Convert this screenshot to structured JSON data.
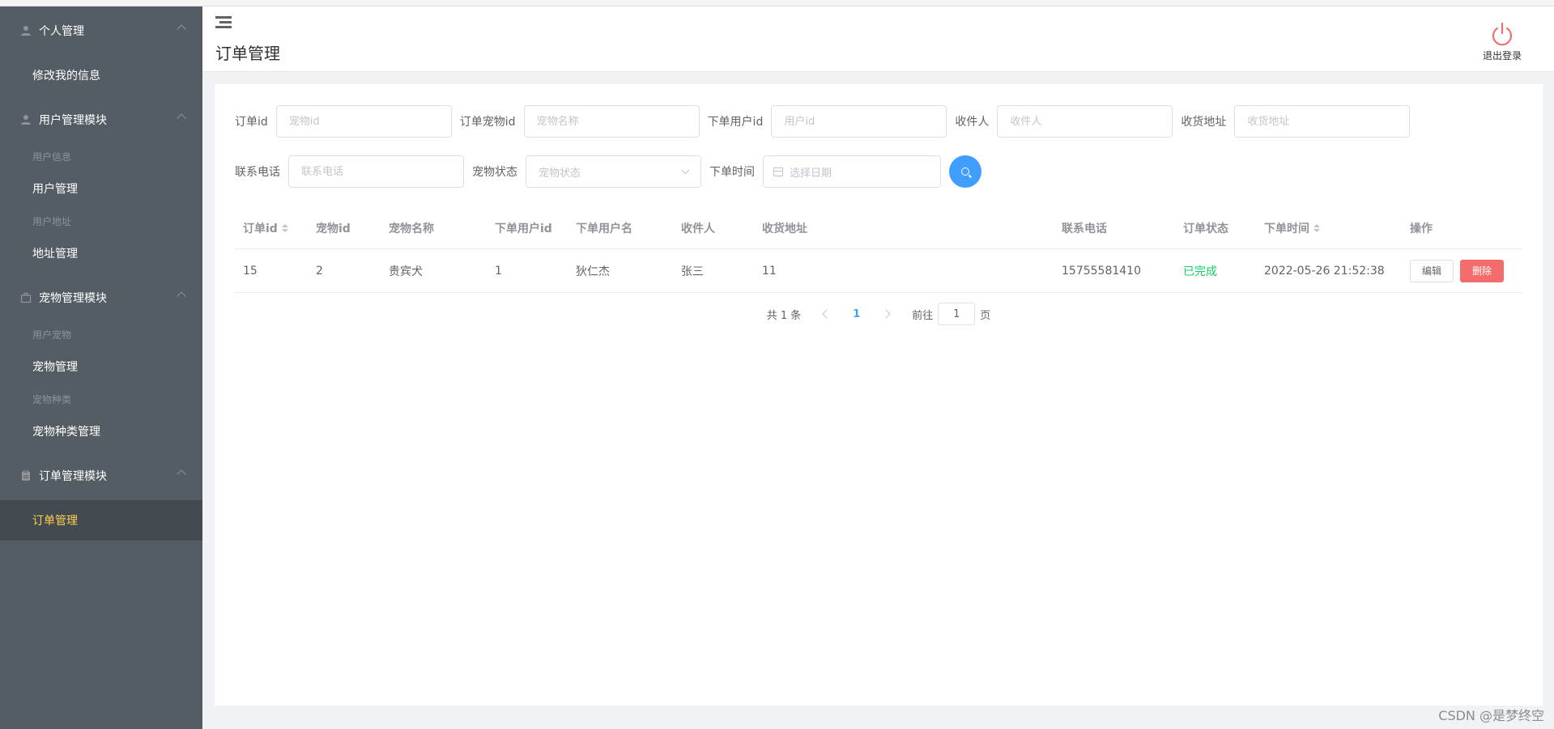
{
  "sidebar": {
    "groups": [
      {
        "title": "个人管理",
        "icon": "user-icon",
        "items": [
          {
            "label": "修改我的信息",
            "style": "item"
          }
        ]
      },
      {
        "title": "用户管理模块",
        "icon": "user-icon",
        "items": [
          {
            "label": "用户信息",
            "style": "small"
          },
          {
            "label": "用户管理",
            "style": "item"
          },
          {
            "label": "用户地址",
            "style": "small"
          },
          {
            "label": "地址管理",
            "style": "item"
          }
        ]
      },
      {
        "title": "宠物管理模块",
        "icon": "briefcase-icon",
        "items": [
          {
            "label": "用户宠物",
            "style": "small"
          },
          {
            "label": "宠物管理",
            "style": "item"
          },
          {
            "label": "宠物种类",
            "style": "small"
          },
          {
            "label": "宠物种类管理",
            "style": "item"
          }
        ]
      },
      {
        "title": "订单管理模块",
        "icon": "clipboard-icon",
        "items": [
          {
            "label": "订单管理",
            "style": "active"
          }
        ]
      }
    ],
    "active_color": "#ffd04b",
    "background": "#545c64"
  },
  "header": {
    "title": "订单管理",
    "logout_label": "退出登录",
    "logout_icon": "power-icon",
    "menu_icon": "menu-fold-icon"
  },
  "filters": {
    "order_id": {
      "label": "订单id",
      "placeholder": "宠物id"
    },
    "pet_id": {
      "label": "订单宠物id",
      "placeholder": "宠物名称"
    },
    "user_id": {
      "label": "下单用户id",
      "placeholder": "用户id"
    },
    "receiver": {
      "label": "收件人",
      "placeholder": "收件人"
    },
    "address": {
      "label": "收货地址",
      "placeholder": "收货地址"
    },
    "phone": {
      "label": "联系电话",
      "placeholder": "联系电话"
    },
    "pet_status": {
      "label": "宠物状态",
      "placeholder": "宠物状态"
    },
    "order_time": {
      "label": "下单时间",
      "placeholder": "选择日期"
    },
    "search_icon": "search-icon"
  },
  "table": {
    "columns": [
      "订单id",
      "宠物id",
      "宠物名称",
      "下单用户id",
      "下单用户名",
      "收件人",
      "收货地址",
      "联系电话",
      "订单状态",
      "下单时间",
      "操作"
    ],
    "rows": [
      {
        "order_id": "15",
        "pet_id": "2",
        "pet_name": "贵宾犬",
        "user_id": "1",
        "username": "狄仁杰",
        "receiver": "张三",
        "address": "11",
        "phone": "15755581410",
        "status": "已完成",
        "time": "2022-05-26 21:52:38",
        "edit": "编辑",
        "delete": "删除"
      }
    ],
    "status_color": "#13ce66"
  },
  "pagination": {
    "total": "共 1 条",
    "current_page": "1",
    "goto_prefix": "前往",
    "goto_value": "1",
    "goto_suffix": "页"
  },
  "watermark": "CSDN @是梦终空",
  "accent": "#409eff"
}
